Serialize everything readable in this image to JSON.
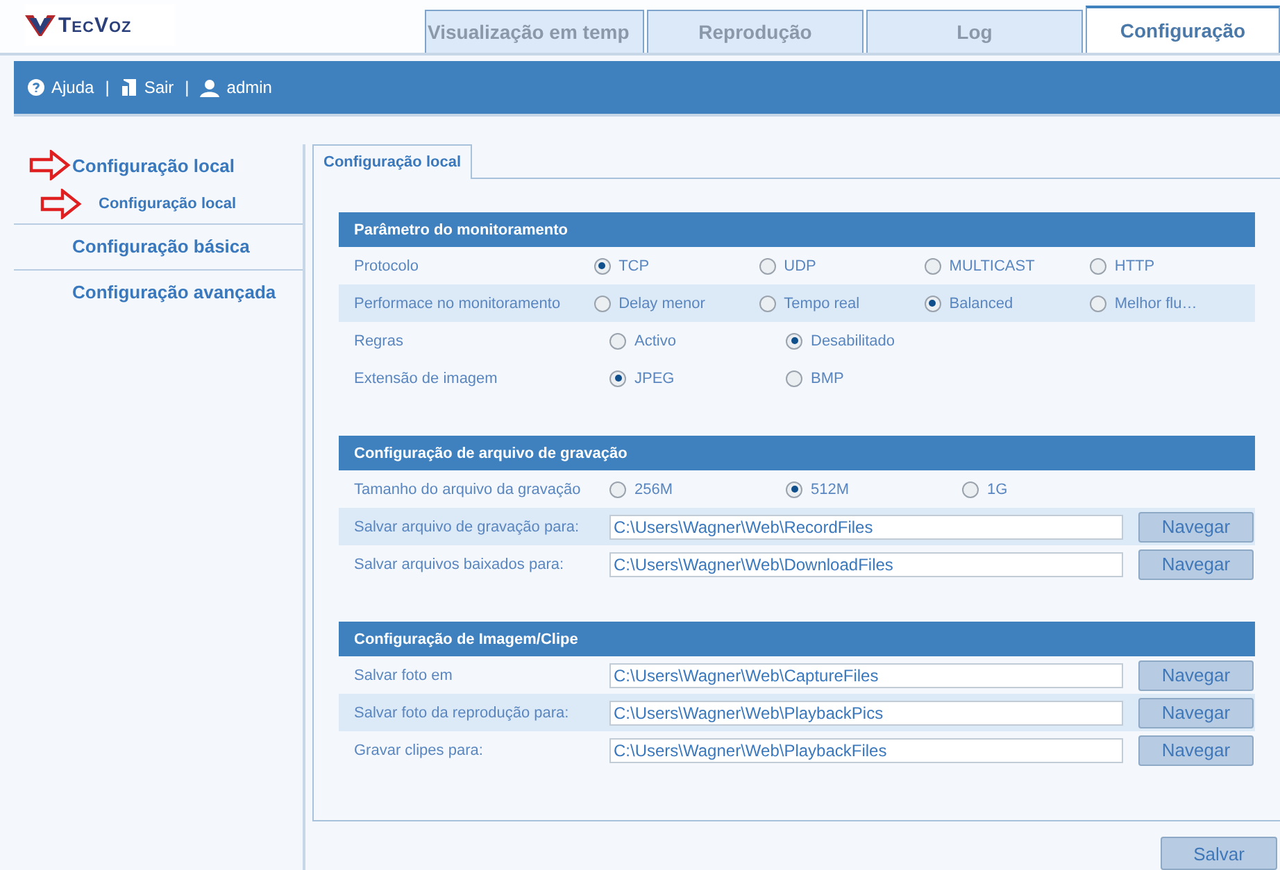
{
  "logo": {
    "text": "TecVoz"
  },
  "tabs": [
    {
      "label": "Visualização em temp",
      "selected": false
    },
    {
      "label": "Reprodução",
      "selected": false
    },
    {
      "label": "Log",
      "selected": false
    },
    {
      "label": "Configuração",
      "selected": true
    }
  ],
  "toolbar": {
    "help": "Ajuda",
    "separator_1": "|",
    "logout": "Sair",
    "separator_2": "|",
    "user": "admin"
  },
  "sidebar": {
    "items": [
      {
        "label": "Configuração local",
        "marked": true,
        "children": [
          {
            "label": "Configuração local",
            "marked": true
          }
        ]
      },
      {
        "label": "Configuração básica",
        "marked": false
      },
      {
        "label": "Configuração avançada",
        "marked": false
      }
    ]
  },
  "content": {
    "tab": {
      "label": "Configuração local",
      "selected": true
    },
    "sections": [
      {
        "title": "Parâmetro do monitoramento",
        "rows": [
          {
            "kind": "radio",
            "label": "Protocolo",
            "options": [
              {
                "label": "TCP",
                "selected": true
              },
              {
                "label": "UDP",
                "selected": false
              },
              {
                "label": "MULTICAST",
                "selected": false
              },
              {
                "label": "HTTP",
                "selected": false
              }
            ]
          },
          {
            "kind": "radio",
            "label": "Performace no monitoramento",
            "options": [
              {
                "label": "Delay menor",
                "selected": false
              },
              {
                "label": "Tempo real",
                "selected": false
              },
              {
                "label": "Balanced",
                "selected": true
              },
              {
                "label": "Melhor flu…",
                "selected": false
              }
            ]
          },
          {
            "kind": "radio",
            "label": "Regras",
            "options": [
              {
                "label": "Activo",
                "selected": false
              },
              {
                "label": "Desabilitado",
                "selected": true
              }
            ]
          },
          {
            "kind": "radio",
            "label": "Extensão de imagem",
            "options": [
              {
                "label": "JPEG",
                "selected": true
              },
              {
                "label": "BMP",
                "selected": false
              }
            ]
          }
        ]
      },
      {
        "title": "Configuração de arquivo de gravação",
        "rows": [
          {
            "kind": "radio",
            "label": "Tamanho do arquivo da gravação",
            "options": [
              {
                "label": "256M",
                "selected": false
              },
              {
                "label": "512M",
                "selected": true
              },
              {
                "label": "1G",
                "selected": false
              }
            ]
          },
          {
            "kind": "path",
            "label": "Salvar arquivo de gravação para:",
            "value": "C:\\Users\\Wagner\\Web\\RecordFiles",
            "button": "Navegar"
          },
          {
            "kind": "path",
            "label": "Salvar arquivos baixados para:",
            "value": "C:\\Users\\Wagner\\Web\\DownloadFiles",
            "button": "Navegar"
          }
        ]
      },
      {
        "title": "Configuração de Imagem/Clipe",
        "rows": [
          {
            "kind": "path",
            "label": "Salvar foto em",
            "value": "C:\\Users\\Wagner\\Web\\CaptureFiles",
            "button": "Navegar"
          },
          {
            "kind": "path",
            "label": "Salvar foto da reprodução para:",
            "value": "C:\\Users\\Wagner\\Web\\PlaybackPics",
            "button": "Navegar"
          },
          {
            "kind": "path",
            "label": "Gravar clipes para:",
            "value": "C:\\Users\\Wagner\\Web\\PlaybackFiles",
            "button": "Navegar"
          }
        ]
      }
    ]
  },
  "save_button": "Salvar"
}
